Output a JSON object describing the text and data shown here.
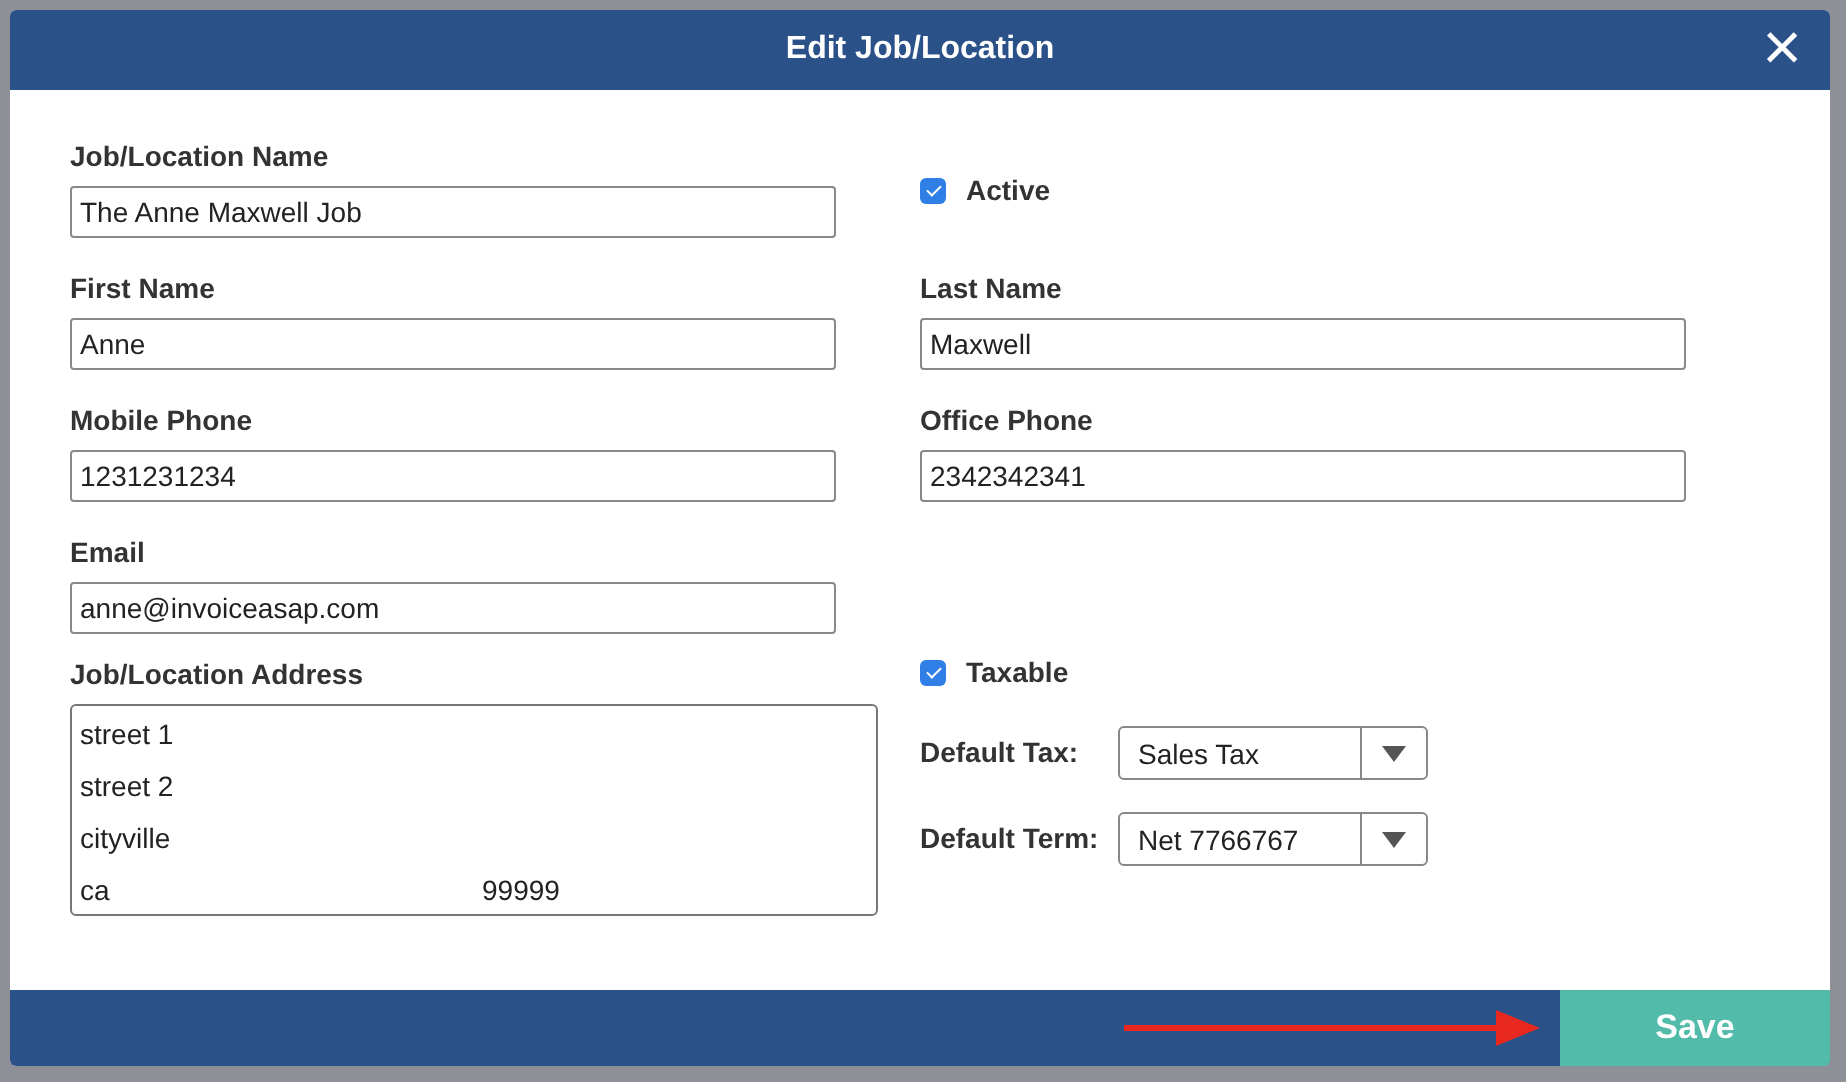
{
  "dialog": {
    "title": "Edit Job/Location",
    "close": "×"
  },
  "fields": [
    {
      "kind": "text",
      "label": "Job/Location Name",
      "value": "The Anne Maxwell Job"
    },
    {
      "kind": "check",
      "label": "Active",
      "checked": true
    },
    {
      "kind": "text",
      "label": "First Name",
      "value": "Anne"
    },
    {
      "kind": "text",
      "label": "Last Name",
      "value": "Maxwell"
    },
    {
      "kind": "text",
      "label": "Mobile Phone",
      "value": "1231231234"
    },
    {
      "kind": "text",
      "label": "Office Phone",
      "value": "2342342341"
    },
    {
      "kind": "text",
      "label": "Email",
      "value": "anne@invoiceasap.com"
    },
    {
      "kind": "empty"
    }
  ],
  "address": {
    "label": "Job/Location Address",
    "lines": [
      "street 1",
      "street 2",
      "cityville"
    ],
    "state": "ca",
    "zip": "99999"
  },
  "taxable": {
    "label": "Taxable",
    "checked": true
  },
  "selects": [
    {
      "label": "Default Tax:",
      "value": "Sales Tax"
    },
    {
      "label": "Default Term:",
      "value": "Net 7766767"
    }
  ],
  "footer": {
    "save": "Save"
  }
}
